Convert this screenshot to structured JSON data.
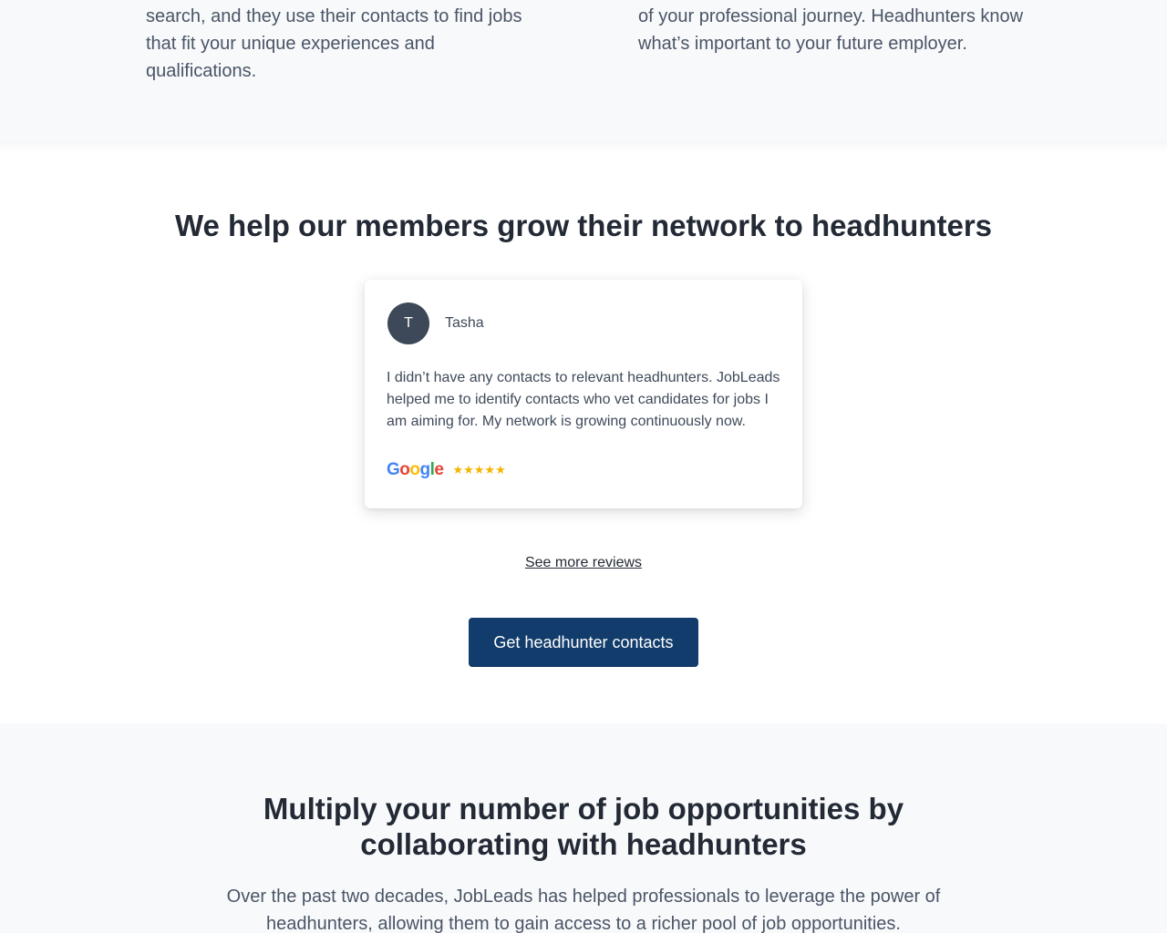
{
  "top_section": {
    "left_text": "search, and they use their contacts to find jobs that fit your unique experiences and qualifications.",
    "right_text": "of your professional journey. Headhunters know what’s important to your future employer."
  },
  "reviews_section": {
    "heading": "We help our members grow their network to headhunters",
    "review": {
      "avatar_initial": "T",
      "name": "Tasha",
      "text": "I didn’t have any contacts to relevant headhunters. JobLeads helped me to identify contacts who vet candidates for jobs I am aiming for. My network is growing continuously now.",
      "source": "Google",
      "source_letters": [
        "G",
        "o",
        "o",
        "g",
        "l",
        "e"
      ],
      "source_colors": [
        "#4285F4",
        "#EA4335",
        "#FBBC05",
        "#4285F4",
        "#34A853",
        "#EA4335"
      ],
      "rating": 5,
      "stars": "★★★★★"
    },
    "see_more_label": "See more reviews",
    "cta_label": "Get headhunter contacts",
    "cta_color": "#123c6b"
  },
  "bottom_section": {
    "heading": "Multiply your number of job opportunities by collaborating with headhunters",
    "text": "Over the past two decades, JobLeads has helped professionals to leverage the power of headhunters, allowing them to gain access to a richer pool of job opportunities."
  }
}
